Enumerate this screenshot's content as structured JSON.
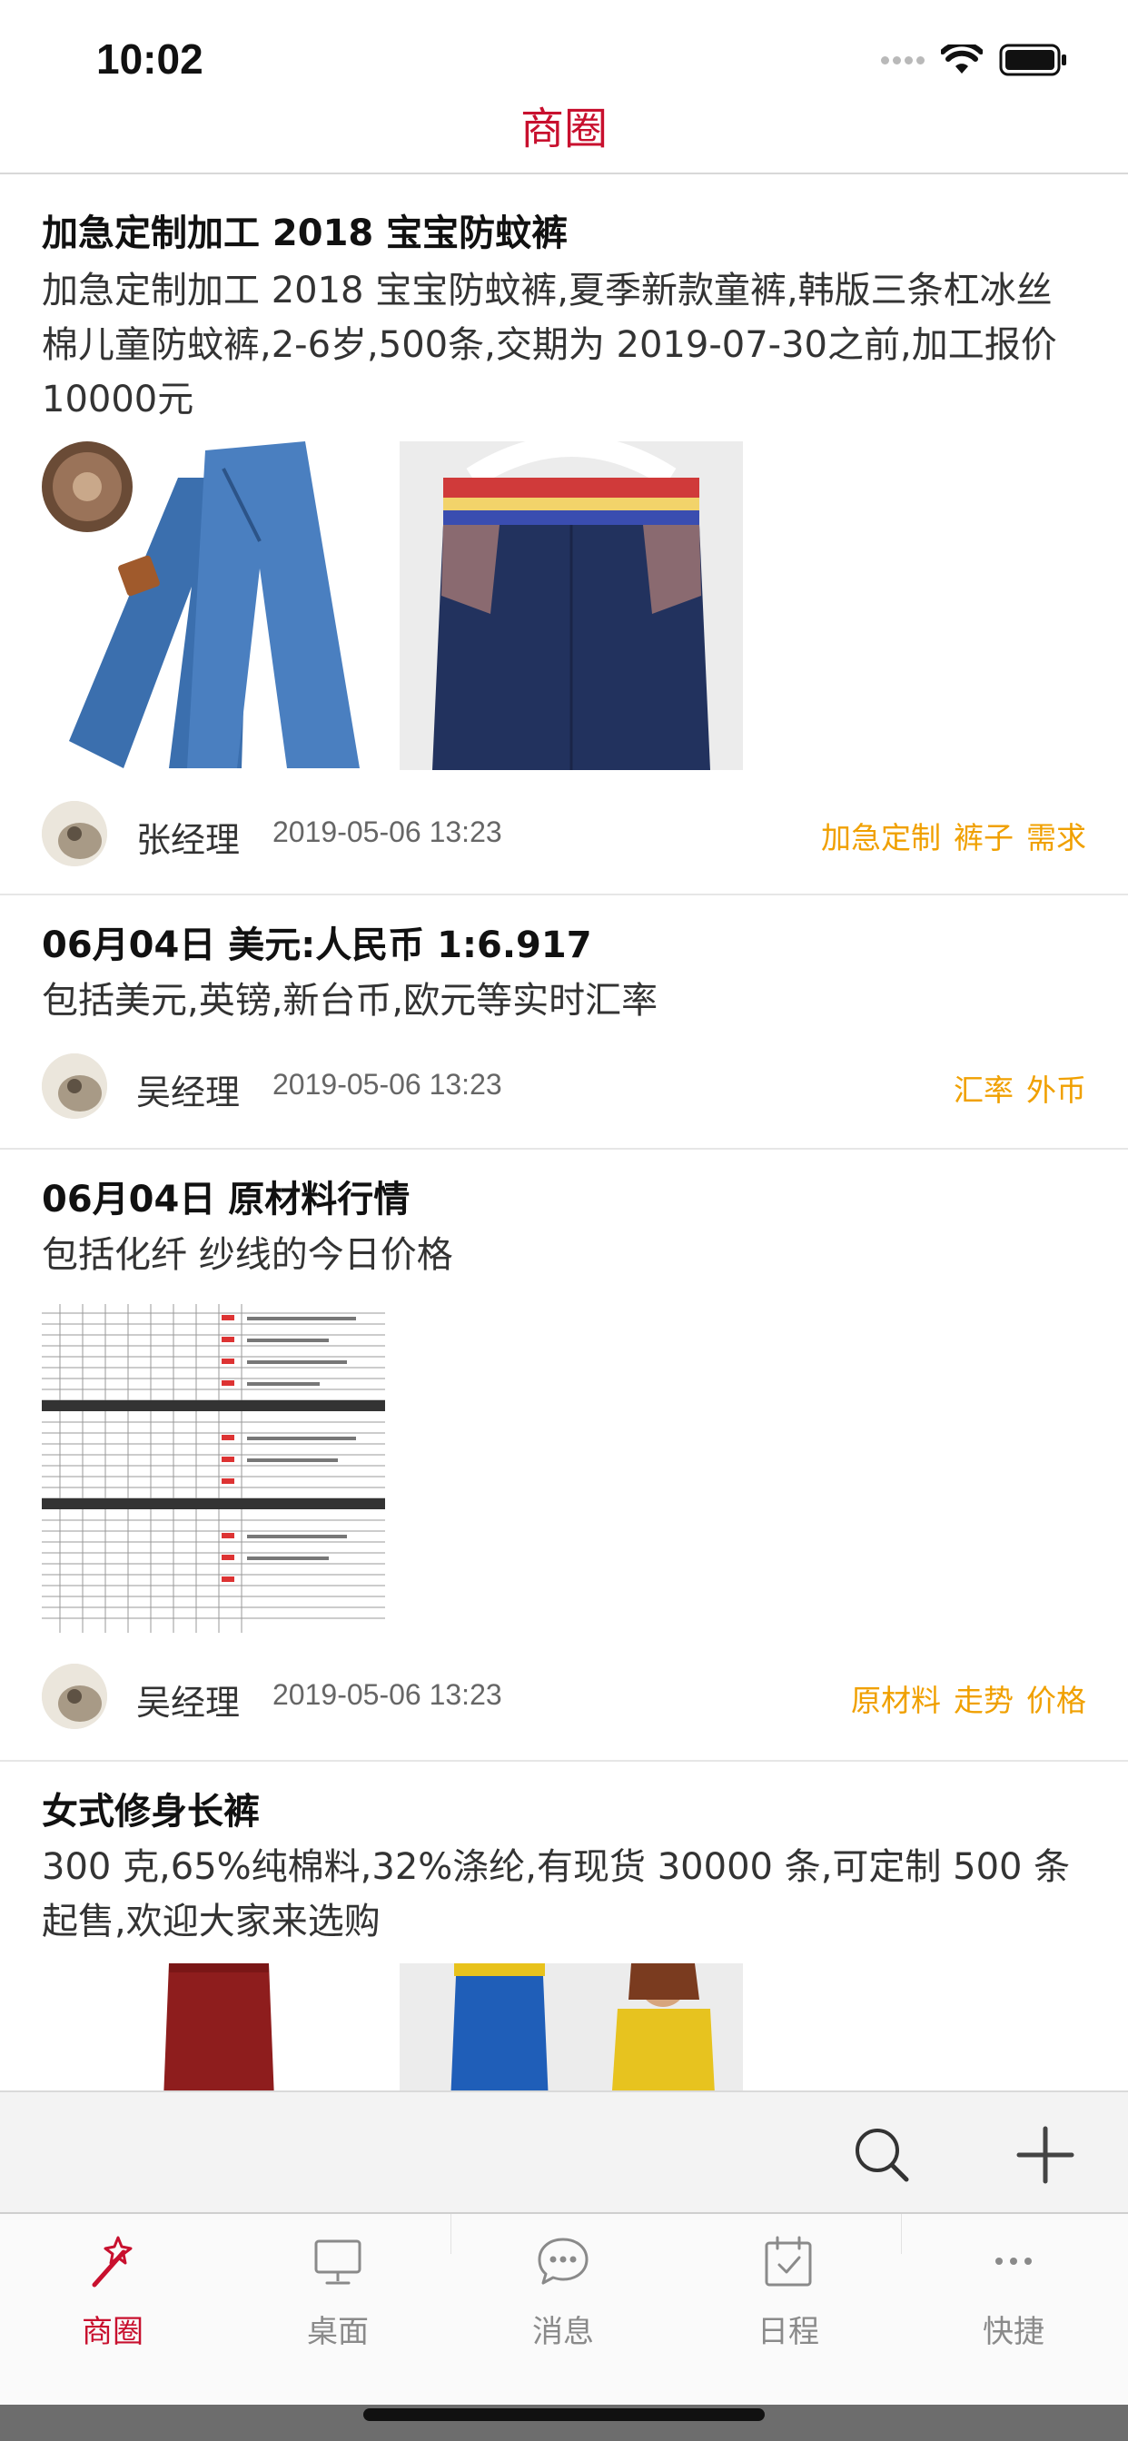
{
  "status_bar": {
    "time": "10:02"
  },
  "nav": {
    "title": "商圈"
  },
  "posts": [
    {
      "title": "加急定制加工 2018 宝宝防蚊裤",
      "body": "加急定制加工 2018 宝宝防蚊裤,夏季新款童裤,韩版三条杠冰丝棉儿童防蚊裤,2-6岁,500条,交期为 2019-07-30之前,加工报价10000元",
      "author": "张经理",
      "time": "2019-05-06 13:23",
      "tags": [
        "加急定制",
        "裤子",
        "需求"
      ]
    },
    {
      "title": "06月04日 美元:人民币 1:6.917",
      "body": "包括美元,英镑,新台币,欧元等实时汇率",
      "author": "吴经理",
      "time": "2019-05-06 13:23",
      "tags": [
        "汇率",
        "外币"
      ]
    },
    {
      "title": "06月04日 原材料行情",
      "body": "包括化纤 纱线的今日价格",
      "author": "吴经理",
      "time": "2019-05-06 13:23",
      "tags": [
        "原材料",
        "走势",
        "价格"
      ]
    },
    {
      "title": "女式修身长裤",
      "body": "300 克,65%纯棉料,32%涤纶,有现货 30000 条,可定制 500 条起售,欢迎大家来选购"
    }
  ],
  "tabs": [
    {
      "label": "商圈",
      "icon": "magic-wand-icon",
      "active": true
    },
    {
      "label": "桌面",
      "icon": "monitor-icon",
      "active": false
    },
    {
      "label": "消息",
      "icon": "chat-bubble-icon",
      "active": false
    },
    {
      "label": "日程",
      "icon": "calendar-check-icon",
      "active": false
    },
    {
      "label": "快捷",
      "icon": "more-dots-icon",
      "active": false
    }
  ],
  "colors": {
    "accent": "#c8102e",
    "tag": "#f0a000",
    "action_bar": "#f3f3f3"
  }
}
